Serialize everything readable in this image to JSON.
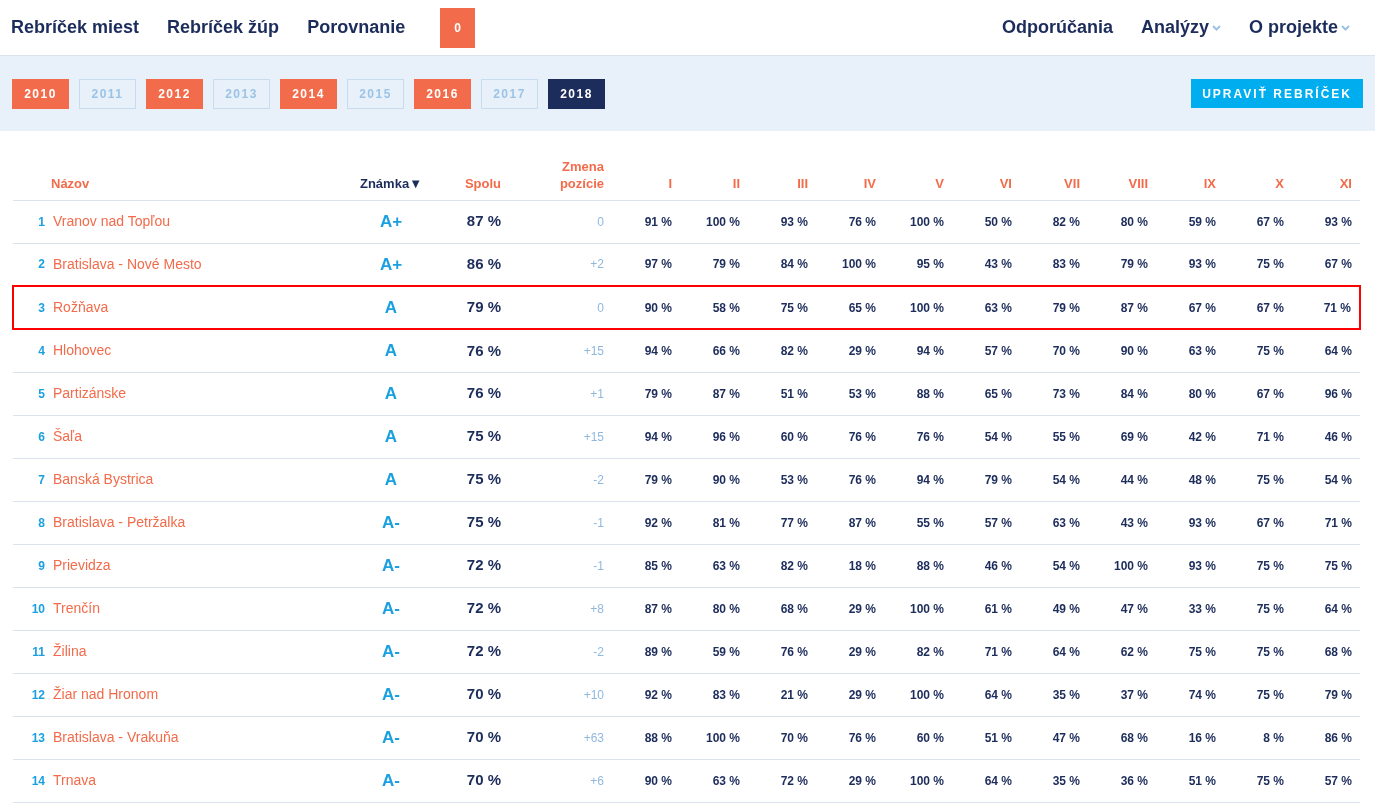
{
  "nav": {
    "left": [
      {
        "label": "Rebríček miest"
      },
      {
        "label": "Rebríček žúp"
      },
      {
        "label": "Porovnanie"
      }
    ],
    "compare_count": "0",
    "right": [
      {
        "label": "Odporúčania",
        "dropdown": false
      },
      {
        "label": "Analýzy",
        "dropdown": true
      },
      {
        "label": "O projekte",
        "dropdown": true
      }
    ]
  },
  "years": [
    {
      "label": "2010",
      "disabled": false,
      "selected": false
    },
    {
      "label": "2011",
      "disabled": true,
      "selected": false
    },
    {
      "label": "2012",
      "disabled": false,
      "selected": false
    },
    {
      "label": "2013",
      "disabled": true,
      "selected": false
    },
    {
      "label": "2014",
      "disabled": false,
      "selected": false
    },
    {
      "label": "2015",
      "disabled": true,
      "selected": false
    },
    {
      "label": "2016",
      "disabled": false,
      "selected": false
    },
    {
      "label": "2017",
      "disabled": true,
      "selected": false
    },
    {
      "label": "2018",
      "disabled": false,
      "selected": true
    }
  ],
  "edit_button": "UPRAVIŤ REBRÍČEK",
  "table": {
    "columns": [
      {
        "label": "Názov",
        "sorted": false
      },
      {
        "label": "Známka",
        "sorted": true,
        "sort_arrow": "▼"
      },
      {
        "label": "Spolu",
        "sorted": false
      },
      {
        "label": "Zmena pozície",
        "sorted": false
      },
      {
        "label": "I",
        "sorted": false
      },
      {
        "label": "II",
        "sorted": false
      },
      {
        "label": "III",
        "sorted": false
      },
      {
        "label": "IV",
        "sorted": false
      },
      {
        "label": "V",
        "sorted": false
      },
      {
        "label": "VI",
        "sorted": false
      },
      {
        "label": "VII",
        "sorted": false
      },
      {
        "label": "VIII",
        "sorted": false
      },
      {
        "label": "IX",
        "sorted": false
      },
      {
        "label": "X",
        "sorted": false
      },
      {
        "label": "XI",
        "sorted": false
      }
    ],
    "rows": [
      {
        "rank": "1",
        "name": "Vranov nad Topľou",
        "grade": "A+",
        "total": "87 %",
        "change": "0",
        "scores": [
          "91 %",
          "100 %",
          "93 %",
          "76 %",
          "100 %",
          "50 %",
          "82 %",
          "80 %",
          "59 %",
          "67 %",
          "93 %"
        ],
        "highlighted": false
      },
      {
        "rank": "2",
        "name": "Bratislava - Nové Mesto",
        "grade": "A+",
        "total": "86 %",
        "change": "+2",
        "scores": [
          "97 %",
          "79 %",
          "84 %",
          "100 %",
          "95 %",
          "43 %",
          "83 %",
          "79 %",
          "93 %",
          "75 %",
          "67 %"
        ],
        "highlighted": false
      },
      {
        "rank": "3",
        "name": "Rožňava",
        "grade": "A",
        "total": "79 %",
        "change": "0",
        "scores": [
          "90 %",
          "58 %",
          "75 %",
          "65 %",
          "100 %",
          "63 %",
          "79 %",
          "87 %",
          "67 %",
          "67 %",
          "71 %"
        ],
        "highlighted": true
      },
      {
        "rank": "4",
        "name": "Hlohovec",
        "grade": "A",
        "total": "76 %",
        "change": "+15",
        "scores": [
          "94 %",
          "66 %",
          "82 %",
          "29 %",
          "94 %",
          "57 %",
          "70 %",
          "90 %",
          "63 %",
          "75 %",
          "64 %"
        ],
        "highlighted": false
      },
      {
        "rank": "5",
        "name": "Partizánske",
        "grade": "A",
        "total": "76 %",
        "change": "+1",
        "scores": [
          "79 %",
          "87 %",
          "51 %",
          "53 %",
          "88 %",
          "65 %",
          "73 %",
          "84 %",
          "80 %",
          "67 %",
          "96 %"
        ],
        "highlighted": false
      },
      {
        "rank": "6",
        "name": "Šaľa",
        "grade": "A",
        "total": "75 %",
        "change": "+15",
        "scores": [
          "94 %",
          "96 %",
          "60 %",
          "76 %",
          "76 %",
          "54 %",
          "55 %",
          "69 %",
          "42 %",
          "71 %",
          "46 %"
        ],
        "highlighted": false
      },
      {
        "rank": "7",
        "name": "Banská Bystrica",
        "grade": "A",
        "total": "75 %",
        "change": "-2",
        "scores": [
          "79 %",
          "90 %",
          "53 %",
          "76 %",
          "94 %",
          "79 %",
          "54 %",
          "44 %",
          "48 %",
          "75 %",
          "54 %"
        ],
        "highlighted": false
      },
      {
        "rank": "8",
        "name": "Bratislava - Petržalka",
        "grade": "A-",
        "total": "75 %",
        "change": "-1",
        "scores": [
          "92 %",
          "81 %",
          "77 %",
          "87 %",
          "55 %",
          "57 %",
          "63 %",
          "43 %",
          "93 %",
          "67 %",
          "71 %"
        ],
        "highlighted": false
      },
      {
        "rank": "9",
        "name": "Prievidza",
        "grade": "A-",
        "total": "72 %",
        "change": "-1",
        "scores": [
          "85 %",
          "63 %",
          "82 %",
          "18 %",
          "88 %",
          "46 %",
          "54 %",
          "100 %",
          "93 %",
          "75 %",
          "75 %"
        ],
        "highlighted": false
      },
      {
        "rank": "10",
        "name": "Trenčín",
        "grade": "A-",
        "total": "72 %",
        "change": "+8",
        "scores": [
          "87 %",
          "80 %",
          "68 %",
          "29 %",
          "100 %",
          "61 %",
          "49 %",
          "47 %",
          "33 %",
          "75 %",
          "64 %"
        ],
        "highlighted": false
      },
      {
        "rank": "11",
        "name": "Žilina",
        "grade": "A-",
        "total": "72 %",
        "change": "-2",
        "scores": [
          "89 %",
          "59 %",
          "76 %",
          "29 %",
          "82 %",
          "71 %",
          "64 %",
          "62 %",
          "75 %",
          "75 %",
          "68 %"
        ],
        "highlighted": false
      },
      {
        "rank": "12",
        "name": "Žiar nad Hronom",
        "grade": "A-",
        "total": "70 %",
        "change": "+10",
        "scores": [
          "92 %",
          "83 %",
          "21 %",
          "29 %",
          "100 %",
          "64 %",
          "35 %",
          "37 %",
          "74 %",
          "75 %",
          "79 %"
        ],
        "highlighted": false
      },
      {
        "rank": "13",
        "name": "Bratislava - Vrakuňa",
        "grade": "A-",
        "total": "70 %",
        "change": "+63",
        "scores": [
          "88 %",
          "100 %",
          "70 %",
          "76 %",
          "60 %",
          "51 %",
          "47 %",
          "68 %",
          "16 %",
          "8 %",
          "86 %"
        ],
        "highlighted": false
      },
      {
        "rank": "14",
        "name": "Trnava",
        "grade": "A-",
        "total": "70 %",
        "change": "+6",
        "scores": [
          "90 %",
          "63 %",
          "72 %",
          "29 %",
          "100 %",
          "64 %",
          "35 %",
          "36 %",
          "51 %",
          "75 %",
          "57 %"
        ],
        "highlighted": false
      }
    ]
  }
}
